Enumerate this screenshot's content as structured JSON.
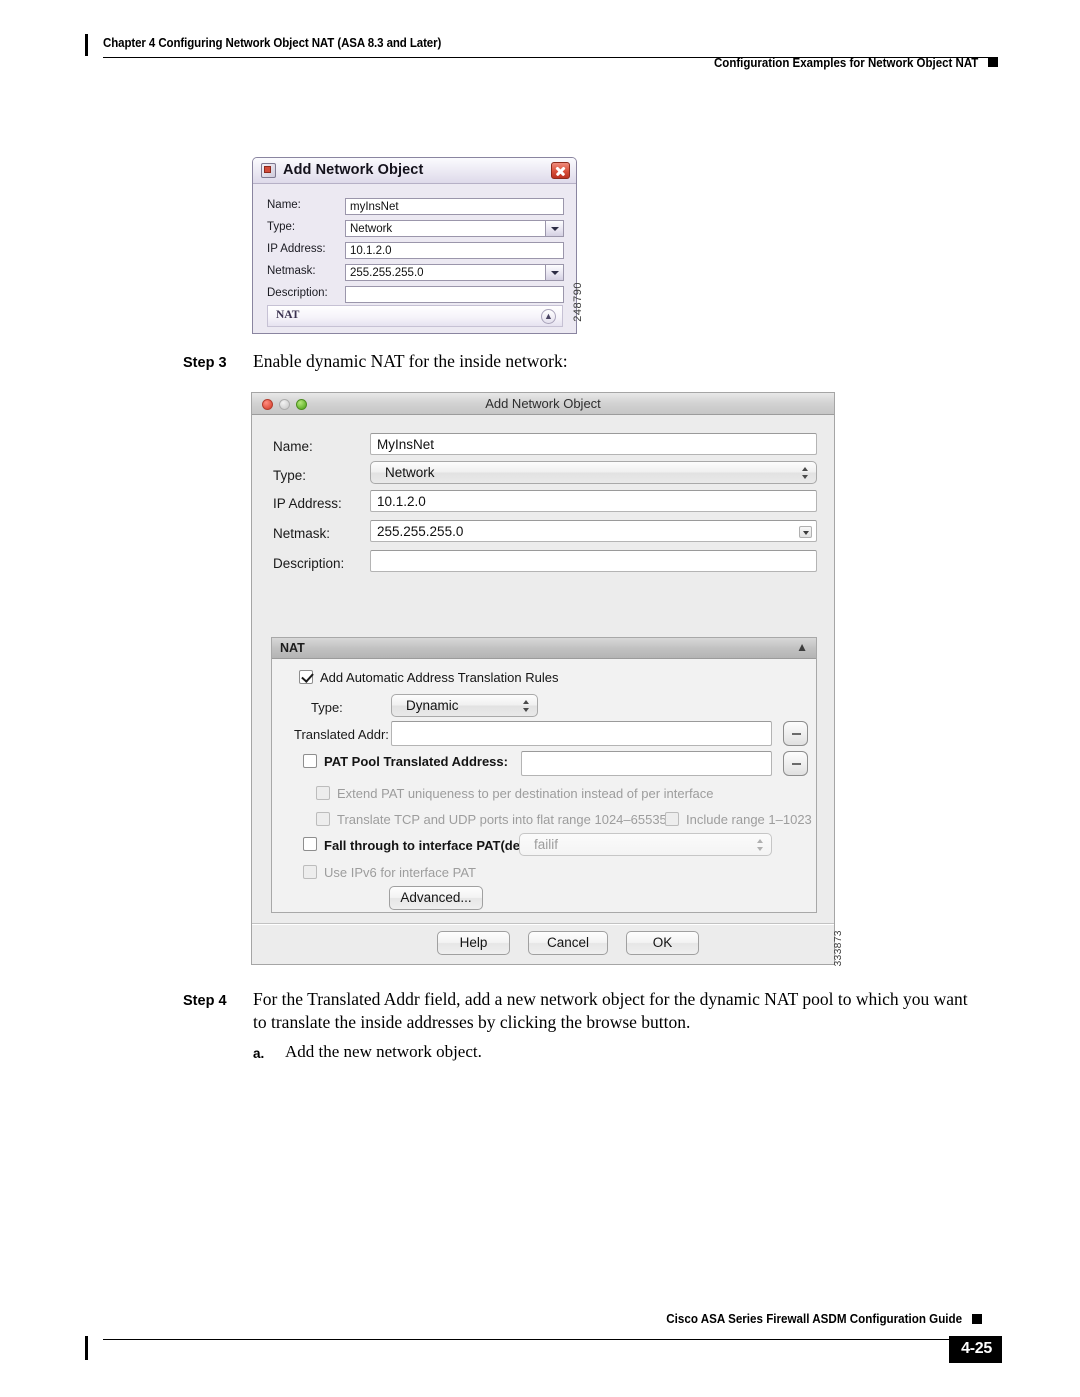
{
  "header": {
    "chapter": "Chapter 4    Configuring Network Object NAT (ASA 8.3 and Later)",
    "running_head": "Configuration Examples for Network Object NAT"
  },
  "footer": {
    "guide_title": "Cisco ASA Series Firewall ASDM Configuration Guide",
    "page_number": "4-25"
  },
  "figure1": {
    "fig_id": "248790",
    "title": "Add Network Object",
    "fields": [
      {
        "label": "Name:",
        "value": "myInsNet"
      },
      {
        "label": "Type:",
        "value": "Network"
      },
      {
        "label": "IP Address:",
        "value": "10.1.2.0"
      },
      {
        "label": "Netmask:",
        "value": "255.255.255.0"
      },
      {
        "label": "Description:",
        "value": ""
      }
    ],
    "nat_section": "NAT"
  },
  "step3": {
    "label": "Step 3",
    "text": "Enable dynamic NAT for the inside network:"
  },
  "figure2": {
    "fig_id": "333873",
    "title": "Add Network Object",
    "fields": [
      {
        "label": "Name:",
        "value": "MyInsNet"
      },
      {
        "label": "Type:",
        "value": "Network"
      },
      {
        "label": "IP Address:",
        "value": "10.1.2.0"
      },
      {
        "label": "Netmask:",
        "value": "255.255.255.0"
      },
      {
        "label": "Description:",
        "value": ""
      }
    ],
    "nat": {
      "section_title": "NAT",
      "auto_rules_label": "Add Automatic Address Translation Rules",
      "type_label": "Type:",
      "type_value": "Dynamic",
      "translated_addr_label": "Translated Addr:",
      "translated_addr_value": "",
      "pat_pool_label": "PAT Pool Translated Address:",
      "pat_pool_value": "",
      "extend_pat_label": "Extend PAT uniqueness to per destination instead of per interface",
      "flat_range_label": "Translate TCP and UDP ports into flat range 1024–65535",
      "include_range_label": "Include range 1–1023",
      "fall_through_label": "Fall through to interface PAT(dest intf):",
      "fall_through_value": "failif",
      "ipv6_pat_label": "Use IPv6 for interface PAT",
      "advanced_label": "Advanced..."
    },
    "buttons": {
      "help": "Help",
      "cancel": "Cancel",
      "ok": "OK"
    }
  },
  "step4": {
    "label": "Step 4",
    "line1": "For the Translated Addr field, add a new network object for the dynamic NAT pool to which you want",
    "line2": "to translate the inside addresses by clicking the browse button.",
    "sub_label": "a.",
    "sub_text": "Add the new network object."
  }
}
